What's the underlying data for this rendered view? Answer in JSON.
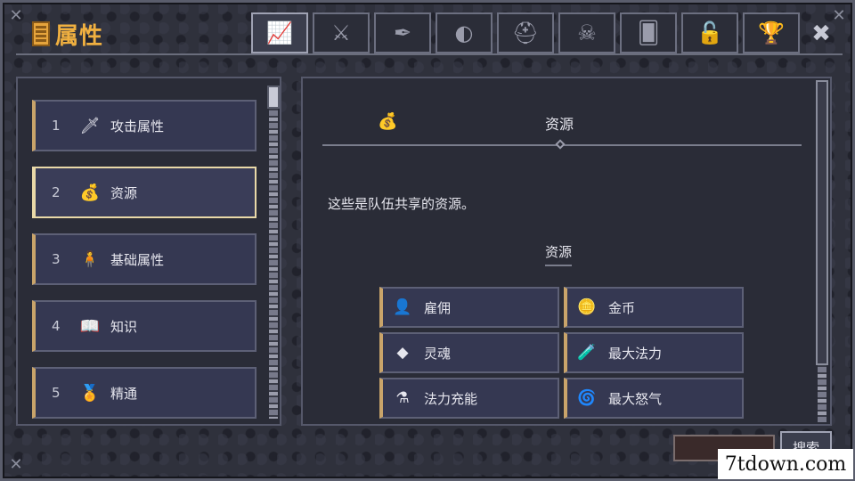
{
  "window": {
    "title": "属性",
    "close_icon": "close-icon"
  },
  "tabs": [
    {
      "icon": "stats-chart-icon",
      "glyph": "📈",
      "active": true
    },
    {
      "icon": "crossed-swords-icon",
      "glyph": "⚔",
      "active": false
    },
    {
      "icon": "feather-icon",
      "glyph": "✒",
      "active": false
    },
    {
      "icon": "mask-icon",
      "glyph": "◐",
      "active": false
    },
    {
      "icon": "helmet-icon",
      "glyph": "⛑",
      "active": false
    },
    {
      "icon": "skull-icon",
      "glyph": "☠",
      "active": false
    },
    {
      "icon": "cards-icon",
      "glyph": "🂠",
      "active": false
    },
    {
      "icon": "unlock-icon",
      "glyph": "🔓",
      "active": false
    },
    {
      "icon": "trophy-icon",
      "glyph": "🏆",
      "active": false
    }
  ],
  "categories": [
    {
      "num": "1",
      "label": "攻击属性",
      "icon": "sword-icon",
      "glyph": "🗡",
      "selected": false
    },
    {
      "num": "2",
      "label": "资源",
      "icon": "resources-icon",
      "glyph": "💰",
      "selected": true
    },
    {
      "num": "3",
      "label": "基础属性",
      "icon": "person-icon",
      "glyph": "🧍",
      "selected": false
    },
    {
      "num": "4",
      "label": "知识",
      "icon": "book-icon",
      "glyph": "📖",
      "selected": false
    },
    {
      "num": "5",
      "label": "精通",
      "icon": "medal-icon",
      "glyph": "🏅",
      "selected": false
    }
  ],
  "section": {
    "title": "资源",
    "icon": "resources-icon",
    "glyph": "💰",
    "description": "这些是队伍共享的资源。",
    "subtitle": "资源"
  },
  "resources": [
    {
      "label": "雇佣",
      "icon": "mercenary-icon",
      "glyph": "👤"
    },
    {
      "label": "金币",
      "icon": "gold-coin-icon",
      "glyph": "🪙"
    },
    {
      "label": "灵魂",
      "icon": "soul-icon",
      "glyph": "◆"
    },
    {
      "label": "最大法力",
      "icon": "max-mana-icon",
      "glyph": "🧪"
    },
    {
      "label": "法力充能",
      "icon": "mana-charge-icon",
      "glyph": "⚗"
    },
    {
      "label": "最大怒气",
      "icon": "max-rage-icon",
      "glyph": "🌀"
    }
  ],
  "footer": {
    "search_label": "搜索"
  },
  "watermark": "7tdown.com"
}
